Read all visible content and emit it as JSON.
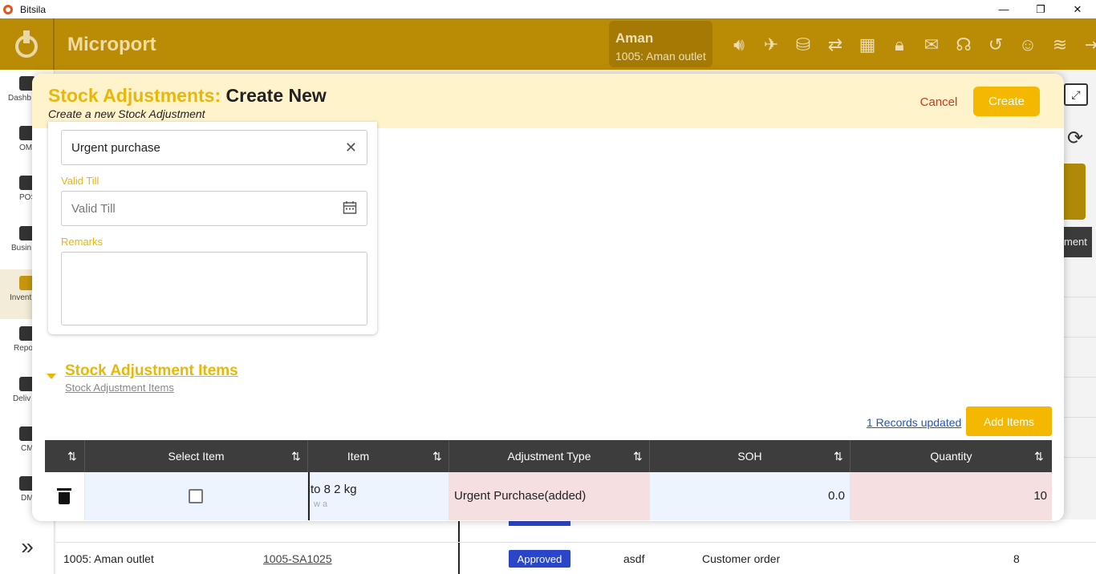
{
  "window": {
    "app_title": "Bitsila",
    "minimize": "—",
    "restore": "❐",
    "close": "✕"
  },
  "header": {
    "brand": "Microport",
    "user_name": "Aman",
    "outlet": "1005: Aman outlet",
    "icons": [
      "speaker-icon",
      "bird-icon",
      "database-icon",
      "sync-icon",
      "apps-grid-icon",
      "lock-icon",
      "mail-icon",
      "headset-icon",
      "history-icon",
      "account-icon",
      "wifi-icon",
      "logout-icon"
    ]
  },
  "leftnav": {
    "items": [
      {
        "label": "Dashb",
        "icon": "dashboard-icon"
      },
      {
        "label": "OM",
        "icon": "briefcase-icon"
      },
      {
        "label": "POS",
        "icon": "pos-icon"
      },
      {
        "label": "Busin",
        "icon": "business-icon"
      },
      {
        "label": "Invent",
        "icon": "inventory-icon"
      },
      {
        "label": "Repo",
        "icon": "reports-icon"
      },
      {
        "label": "Deliv",
        "icon": "delivery-icon"
      },
      {
        "label": "CM",
        "icon": "cm-icon"
      },
      {
        "label": "DM",
        "icon": "dm-icon"
      }
    ],
    "expand": "»"
  },
  "background": {
    "side_text": "ment",
    "row": {
      "outlet": "1005: Aman outlet",
      "doc": "1005-SA1025",
      "status": "Approved",
      "col4": "asdf",
      "reason": "Customer order",
      "qty": "8"
    }
  },
  "modal": {
    "title_prefix": "Stock Adjustments:",
    "title_main": "Create New",
    "subtitle": "Create a new Stock Adjustment",
    "cancel_label": "Cancel",
    "create_label": "Create",
    "form": {
      "reason_value": "Urgent purchase",
      "valid_till_label": "Valid Till",
      "valid_till_placeholder": "Valid Till",
      "remarks_label": "Remarks"
    },
    "section": {
      "title": "Stock Adjustment Items",
      "subtitle": "Stock Adjustment Items"
    },
    "records_link": "1 Records updated",
    "add_items_label": "Add Items",
    "table": {
      "headers": [
        "Select Item",
        "Item",
        "Adjustment Type",
        "SOH",
        "Quantity"
      ],
      "rows": [
        {
          "item": "to 8 2 kg",
          "item_sub": "w a",
          "adjustment_type": "Urgent Purchase(added)",
          "soh": "0.0",
          "quantity": "10"
        }
      ]
    }
  },
  "colors": {
    "accent": "#f5b800",
    "header_bg": "#ba8b04",
    "modal_head_bg": "#fff3cc",
    "cancel": "#c73a1a",
    "status_approved": "#2a45c8"
  }
}
